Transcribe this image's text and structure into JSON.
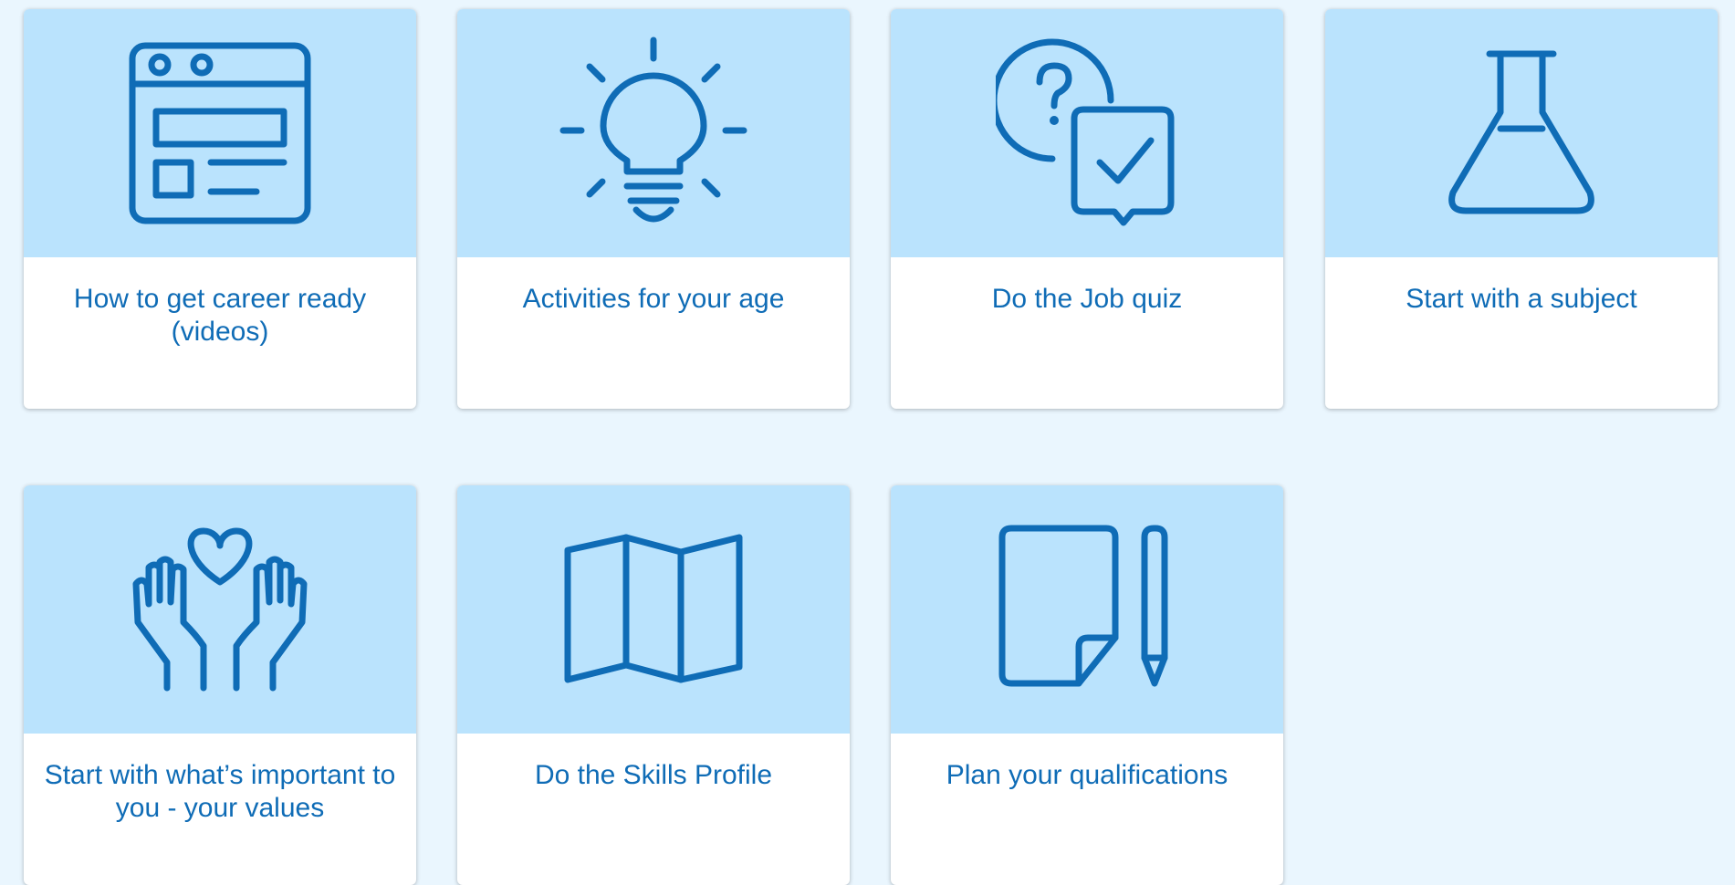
{
  "colors": {
    "page_background": "#eaf6fe",
    "card_top_background": "#bae3fd",
    "card_background": "#ffffff",
    "accent": "#0f6cb6"
  },
  "cards": [
    {
      "label": "How to get career ready (videos)",
      "icon": "browser-window-icon"
    },
    {
      "label": "Activities for your age",
      "icon": "lightbulb-icon"
    },
    {
      "label": "Do the Job quiz",
      "icon": "quiz-question-check-icon"
    },
    {
      "label": "Start with a subject",
      "icon": "flask-icon"
    },
    {
      "label": "Start with what’s important to you - your values",
      "icon": "hands-heart-icon"
    },
    {
      "label": "Do the Skills Profile",
      "icon": "folded-map-icon"
    },
    {
      "label": "Plan your qualifications",
      "icon": "paper-pencil-icon"
    }
  ]
}
